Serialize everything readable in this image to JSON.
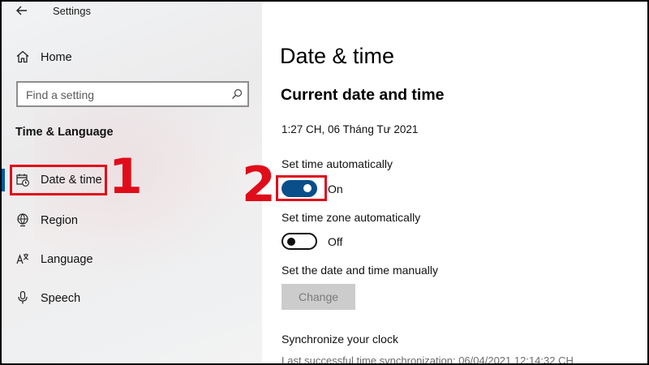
{
  "app": {
    "title": "Settings"
  },
  "sidebar": {
    "home_label": "Home",
    "search": {
      "placeholder": "Find a setting"
    },
    "section_title": "Time & Language",
    "items": [
      {
        "id": "date-time",
        "label": "Date & time",
        "icon": "calendar-clock-icon",
        "selected": true
      },
      {
        "id": "region",
        "label": "Region",
        "icon": "globe-icon"
      },
      {
        "id": "language",
        "label": "Language",
        "icon": "language-icon"
      },
      {
        "id": "speech",
        "label": "Speech",
        "icon": "microphone-icon"
      }
    ]
  },
  "main": {
    "title": "Date & time",
    "subtitle": "Current date and time",
    "current_datetime": "1:27 CH, 06 Tháng Tư 2021",
    "set_time_auto": {
      "label": "Set time automatically",
      "state": "On",
      "on": true
    },
    "set_zone_auto": {
      "label": "Set time zone automatically",
      "state": "Off",
      "on": false
    },
    "manual": {
      "label": "Set the date and time manually",
      "button": "Change",
      "enabled": false
    },
    "sync": {
      "label": "Synchronize your clock",
      "status": "Last successful time synchronization: 06/04/2021 12:14:32 CH"
    }
  },
  "annotations": {
    "marker_1": "1",
    "marker_2": "2"
  },
  "colors": {
    "accent": "#0a4f8a",
    "highlight": "#e00c1a",
    "selection_bar": "#005a9e"
  }
}
